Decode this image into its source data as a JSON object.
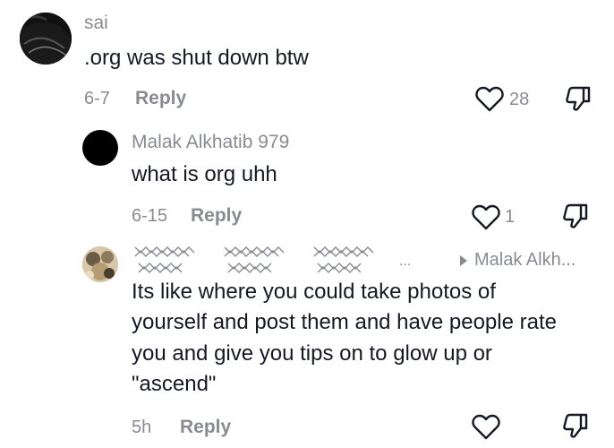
{
  "comments": [
    {
      "username": "sai",
      "text": ".org was shut down btw",
      "time": "6-7",
      "reply_label": "Reply",
      "likes": "28"
    },
    {
      "username": "Malak Alkhatib 979",
      "text": "what is org uhh",
      "time": "6-15",
      "reply_label": "Reply",
      "likes": "1"
    },
    {
      "username_ellipsis": "...",
      "reply_to": "Malak Alkh...",
      "text_lines": [
        "Its like where you could take photos of",
        "yourself and post them and have people rate",
        "you and give you tips on to glow up or",
        "\"ascend\""
      ],
      "time": "5h",
      "reply_label": "Reply",
      "likes": ""
    }
  ],
  "icons": {
    "like": "heart-outline-icon",
    "dislike": "thumbs-down-outline-icon",
    "reply_to": "play-triangle-icon"
  },
  "colors": {
    "text": "#161823",
    "muted": "#8a8b91"
  }
}
